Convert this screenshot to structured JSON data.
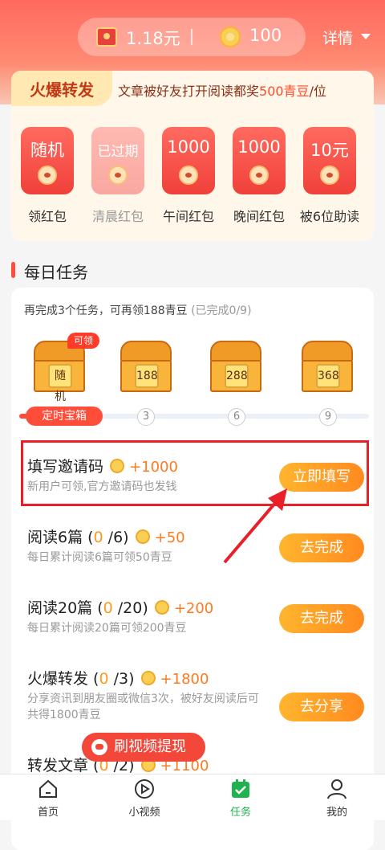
{
  "header": {
    "cash": "1.18元",
    "coins": "100",
    "detail": "详情"
  },
  "hot_share": {
    "title": "火爆转发",
    "desc_prefix": "文章被好友打开阅读都奖",
    "desc_highlight": "500青豆",
    "desc_suffix": "/位",
    "envelopes": [
      {
        "top": "随机",
        "label": "领红包",
        "expired": false
      },
      {
        "top": "已过期",
        "label": "清晨红包",
        "expired": true
      },
      {
        "top": "1000",
        "label": "午间红包",
        "expired": false
      },
      {
        "top": "1000",
        "label": "晚间红包",
        "expired": false
      },
      {
        "top": "10元",
        "label": "被6位助读",
        "expired": false
      }
    ]
  },
  "daily": {
    "title": "每日任务",
    "hint": "再完成3个任务，可再领188青豆",
    "hint_sub": "(已完成0/9)",
    "chests": [
      {
        "label": "随机",
        "badge": "可领"
      },
      {
        "label": "188",
        "badge": ""
      },
      {
        "label": "288",
        "badge": ""
      },
      {
        "label": "368",
        "badge": ""
      }
    ],
    "progress_start": "定时宝箱",
    "progress_marks": [
      "3",
      "6",
      "9"
    ],
    "tasks": [
      {
        "title": "填写邀请码",
        "count": "",
        "count_suffix": "",
        "reward": "+1000",
        "desc": "新用户可领,官方邀请码也发钱",
        "button": "立即填写"
      },
      {
        "title": "阅读6篇 (",
        "count": "0",
        "count_suffix": " /6)",
        "reward": "+50",
        "desc": "每日累计阅读6篇可领50青豆",
        "button": "去完成"
      },
      {
        "title": "阅读20篇 (",
        "count": "0",
        "count_suffix": " /20)",
        "reward": "+200",
        "desc": "每日累计阅读20篇可领200青豆",
        "button": "去完成"
      },
      {
        "title": "火爆转发 (",
        "count": "0",
        "count_suffix": " /3)",
        "reward": "+1800",
        "desc": "分享资讯到朋友圈或微信3次，被好友阅读后可共得1800青豆",
        "button": "去分享"
      },
      {
        "title": "转发文章 (",
        "count": "0",
        "count_suffix": " /2)",
        "reward": "+1100",
        "desc": "",
        "button": ""
      }
    ]
  },
  "float_pill": "刷视频提现",
  "nav": [
    {
      "label": "首页",
      "icon": "home-icon"
    },
    {
      "label": "小视频",
      "icon": "play-icon"
    },
    {
      "label": "任务",
      "icon": "task-icon",
      "active": true
    },
    {
      "label": "我的",
      "icon": "user-icon"
    }
  ],
  "colors": {
    "accent": "#ff4d3a",
    "active_tab": "#20b24f",
    "button": "#ff9a22"
  }
}
